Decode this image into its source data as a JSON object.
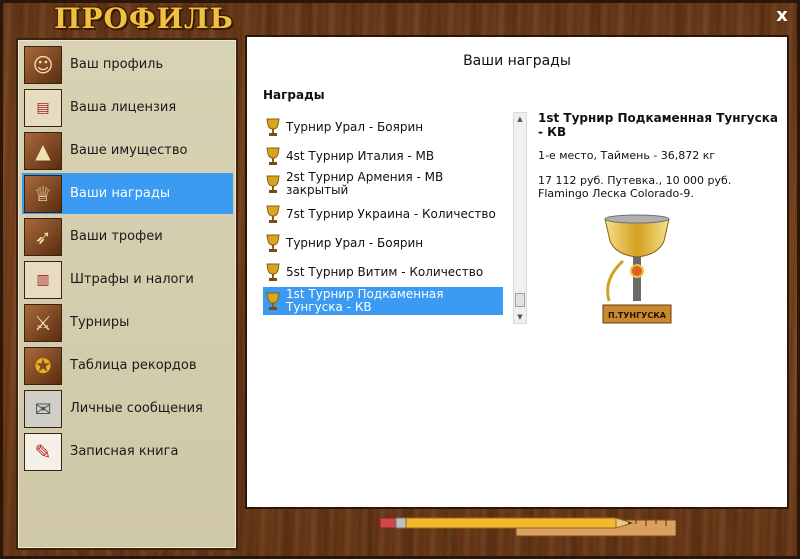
{
  "window": {
    "title": "ПРОФИЛЬ",
    "close_label": "x"
  },
  "sidebar": {
    "items": [
      {
        "label": "Ваш профиль",
        "icon": "fisherman-icon",
        "active": false
      },
      {
        "label": "Ваша лицензия",
        "icon": "license-icon",
        "active": false
      },
      {
        "label": "Ваше имущество",
        "icon": "property-icon",
        "active": false
      },
      {
        "label": "Ваши награды",
        "icon": "trophy-icon",
        "active": true
      },
      {
        "label": "Ваши трофеи",
        "icon": "fish-icon",
        "active": false
      },
      {
        "label": "Штрафы и налоги",
        "icon": "fine-document-icon",
        "active": false
      },
      {
        "label": "Турниры",
        "icon": "tournament-icon",
        "active": false
      },
      {
        "label": "Таблица рекордов",
        "icon": "records-medal-icon",
        "active": false
      },
      {
        "label": "Личные сообщения",
        "icon": "envelope-icon",
        "active": false
      },
      {
        "label": "Записная книга",
        "icon": "notebook-icon",
        "active": false
      }
    ]
  },
  "main": {
    "heading": "Ваши награды",
    "subheading": "Награды",
    "awards": [
      {
        "label": "Турнир Урал - Боярин",
        "selected": false
      },
      {
        "label": "4st Турнир Италия - MB",
        "selected": false
      },
      {
        "label": "2st Турнир Армения - MB закрытый",
        "selected": false
      },
      {
        "label": "7st Турнир Украина - Количество",
        "selected": false
      },
      {
        "label": "Турнир Урал - Боярин",
        "selected": false
      },
      {
        "label": "5st Турнир Витим - Количество",
        "selected": false
      },
      {
        "label": "1st Турнир Подкаменная Тунгуска - КВ",
        "selected": true
      }
    ],
    "detail": {
      "title": "1st Турнир Подкаменная Тунгуска - КВ",
      "place": "1-е место, Таймень - 36,872 кг",
      "prize": "17 112 руб. Путевка., 10 000 руб. Flamingo Леска Colorado-9.",
      "trophy_plate": "П.ТУНГУСКА"
    }
  },
  "colors": {
    "accent": "#3b9af2",
    "title": "#f0c040",
    "panel": "#d8d2b4"
  }
}
